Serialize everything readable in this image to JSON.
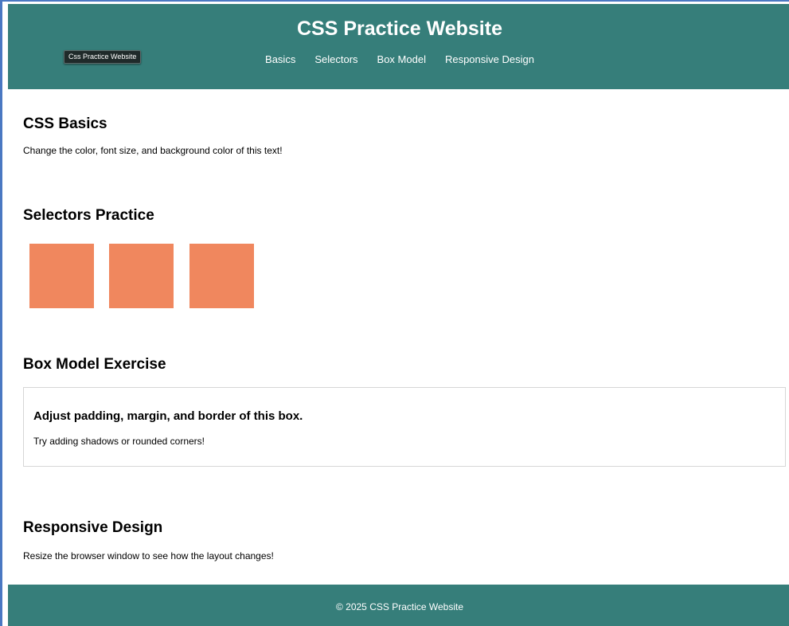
{
  "header": {
    "title": "CSS Practice Website",
    "tooltip": "Css Practice Website",
    "nav": [
      {
        "label": "Basics"
      },
      {
        "label": "Selectors"
      },
      {
        "label": "Box Model"
      },
      {
        "label": "Responsive Design"
      }
    ]
  },
  "sections": {
    "basics": {
      "heading": "CSS Basics",
      "text": "Change the color, font size, and background color of this text!"
    },
    "selectors": {
      "heading": "Selectors Practice"
    },
    "box_model": {
      "heading": "Box Model Exercise",
      "box_heading": "Adjust padding, margin, and border of this box.",
      "box_text": "Try adding shadows or rounded corners!"
    },
    "responsive": {
      "heading": "Responsive Design",
      "text": "Resize the browser window to see how the layout changes!"
    }
  },
  "footer": {
    "text": "© 2025 CSS Practice Website"
  },
  "colors": {
    "header_bg": "#367e7a",
    "square": "#f0875e",
    "frame_border": "#4a78c2"
  }
}
